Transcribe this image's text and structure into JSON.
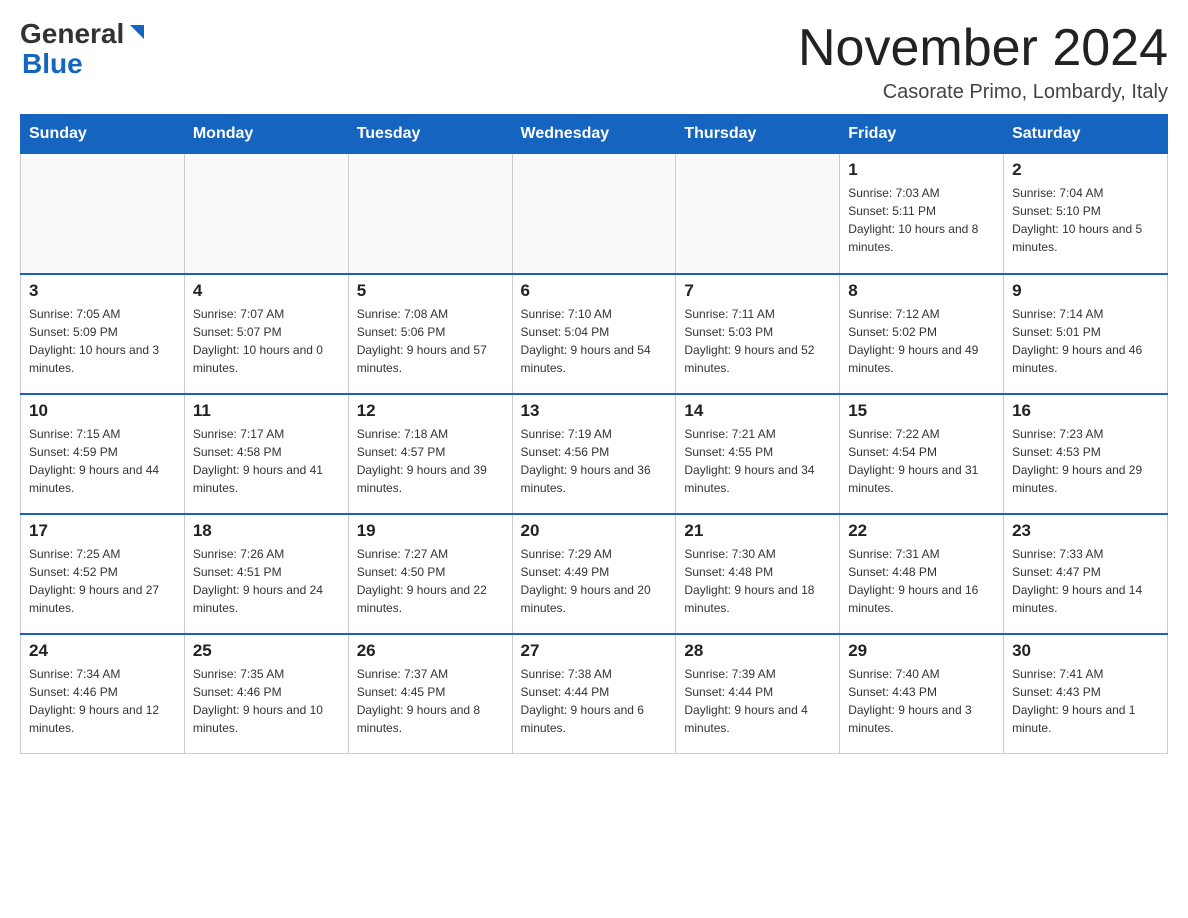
{
  "header": {
    "title": "November 2024",
    "location": "Casorate Primo, Lombardy, Italy",
    "logo_general": "General",
    "logo_blue": "Blue"
  },
  "weekdays": [
    "Sunday",
    "Monday",
    "Tuesday",
    "Wednesday",
    "Thursday",
    "Friday",
    "Saturday"
  ],
  "weeks": [
    [
      {
        "day": "",
        "info": ""
      },
      {
        "day": "",
        "info": ""
      },
      {
        "day": "",
        "info": ""
      },
      {
        "day": "",
        "info": ""
      },
      {
        "day": "",
        "info": ""
      },
      {
        "day": "1",
        "info": "Sunrise: 7:03 AM\nSunset: 5:11 PM\nDaylight: 10 hours and 8 minutes."
      },
      {
        "day": "2",
        "info": "Sunrise: 7:04 AM\nSunset: 5:10 PM\nDaylight: 10 hours and 5 minutes."
      }
    ],
    [
      {
        "day": "3",
        "info": "Sunrise: 7:05 AM\nSunset: 5:09 PM\nDaylight: 10 hours and 3 minutes."
      },
      {
        "day": "4",
        "info": "Sunrise: 7:07 AM\nSunset: 5:07 PM\nDaylight: 10 hours and 0 minutes."
      },
      {
        "day": "5",
        "info": "Sunrise: 7:08 AM\nSunset: 5:06 PM\nDaylight: 9 hours and 57 minutes."
      },
      {
        "day": "6",
        "info": "Sunrise: 7:10 AM\nSunset: 5:04 PM\nDaylight: 9 hours and 54 minutes."
      },
      {
        "day": "7",
        "info": "Sunrise: 7:11 AM\nSunset: 5:03 PM\nDaylight: 9 hours and 52 minutes."
      },
      {
        "day": "8",
        "info": "Sunrise: 7:12 AM\nSunset: 5:02 PM\nDaylight: 9 hours and 49 minutes."
      },
      {
        "day": "9",
        "info": "Sunrise: 7:14 AM\nSunset: 5:01 PM\nDaylight: 9 hours and 46 minutes."
      }
    ],
    [
      {
        "day": "10",
        "info": "Sunrise: 7:15 AM\nSunset: 4:59 PM\nDaylight: 9 hours and 44 minutes."
      },
      {
        "day": "11",
        "info": "Sunrise: 7:17 AM\nSunset: 4:58 PM\nDaylight: 9 hours and 41 minutes."
      },
      {
        "day": "12",
        "info": "Sunrise: 7:18 AM\nSunset: 4:57 PM\nDaylight: 9 hours and 39 minutes."
      },
      {
        "day": "13",
        "info": "Sunrise: 7:19 AM\nSunset: 4:56 PM\nDaylight: 9 hours and 36 minutes."
      },
      {
        "day": "14",
        "info": "Sunrise: 7:21 AM\nSunset: 4:55 PM\nDaylight: 9 hours and 34 minutes."
      },
      {
        "day": "15",
        "info": "Sunrise: 7:22 AM\nSunset: 4:54 PM\nDaylight: 9 hours and 31 minutes."
      },
      {
        "day": "16",
        "info": "Sunrise: 7:23 AM\nSunset: 4:53 PM\nDaylight: 9 hours and 29 minutes."
      }
    ],
    [
      {
        "day": "17",
        "info": "Sunrise: 7:25 AM\nSunset: 4:52 PM\nDaylight: 9 hours and 27 minutes."
      },
      {
        "day": "18",
        "info": "Sunrise: 7:26 AM\nSunset: 4:51 PM\nDaylight: 9 hours and 24 minutes."
      },
      {
        "day": "19",
        "info": "Sunrise: 7:27 AM\nSunset: 4:50 PM\nDaylight: 9 hours and 22 minutes."
      },
      {
        "day": "20",
        "info": "Sunrise: 7:29 AM\nSunset: 4:49 PM\nDaylight: 9 hours and 20 minutes."
      },
      {
        "day": "21",
        "info": "Sunrise: 7:30 AM\nSunset: 4:48 PM\nDaylight: 9 hours and 18 minutes."
      },
      {
        "day": "22",
        "info": "Sunrise: 7:31 AM\nSunset: 4:48 PM\nDaylight: 9 hours and 16 minutes."
      },
      {
        "day": "23",
        "info": "Sunrise: 7:33 AM\nSunset: 4:47 PM\nDaylight: 9 hours and 14 minutes."
      }
    ],
    [
      {
        "day": "24",
        "info": "Sunrise: 7:34 AM\nSunset: 4:46 PM\nDaylight: 9 hours and 12 minutes."
      },
      {
        "day": "25",
        "info": "Sunrise: 7:35 AM\nSunset: 4:46 PM\nDaylight: 9 hours and 10 minutes."
      },
      {
        "day": "26",
        "info": "Sunrise: 7:37 AM\nSunset: 4:45 PM\nDaylight: 9 hours and 8 minutes."
      },
      {
        "day": "27",
        "info": "Sunrise: 7:38 AM\nSunset: 4:44 PM\nDaylight: 9 hours and 6 minutes."
      },
      {
        "day": "28",
        "info": "Sunrise: 7:39 AM\nSunset: 4:44 PM\nDaylight: 9 hours and 4 minutes."
      },
      {
        "day": "29",
        "info": "Sunrise: 7:40 AM\nSunset: 4:43 PM\nDaylight: 9 hours and 3 minutes."
      },
      {
        "day": "30",
        "info": "Sunrise: 7:41 AM\nSunset: 4:43 PM\nDaylight: 9 hours and 1 minute."
      }
    ]
  ]
}
